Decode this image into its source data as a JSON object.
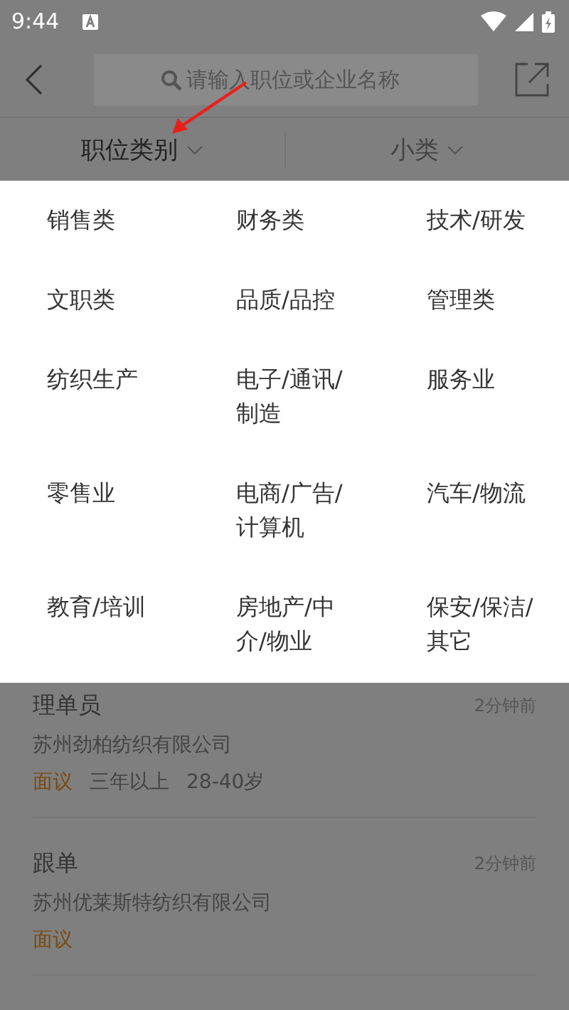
{
  "status_bar": {
    "time": "9:44"
  },
  "search": {
    "placeholder": "请输入职位或企业名称"
  },
  "filters": [
    {
      "label": "职位类别",
      "selected": true
    },
    {
      "label": "小类",
      "selected": false
    }
  ],
  "categories": [
    "销售类",
    "财务类",
    "技术/研发",
    "文职类",
    "品质/品控",
    "管理类",
    "纺织生产",
    "电子/通讯/制造",
    "服务业",
    "零售业",
    "电商/广告/计算机",
    "汽车/物流",
    "教育/培训",
    "房地产/中介/物业",
    "保安/保洁/其它"
  ],
  "jobs": [
    {
      "title": "理单员",
      "time": "2分钟前",
      "company": "苏州劲柏纺织有限公司",
      "salary": "面议",
      "tags": [
        "三年以上",
        "28-40岁"
      ]
    },
    {
      "title": "跟单",
      "time": "2分钟前",
      "company": "苏州优莱斯特纺织有限公司",
      "salary": "面议"
    }
  ]
}
